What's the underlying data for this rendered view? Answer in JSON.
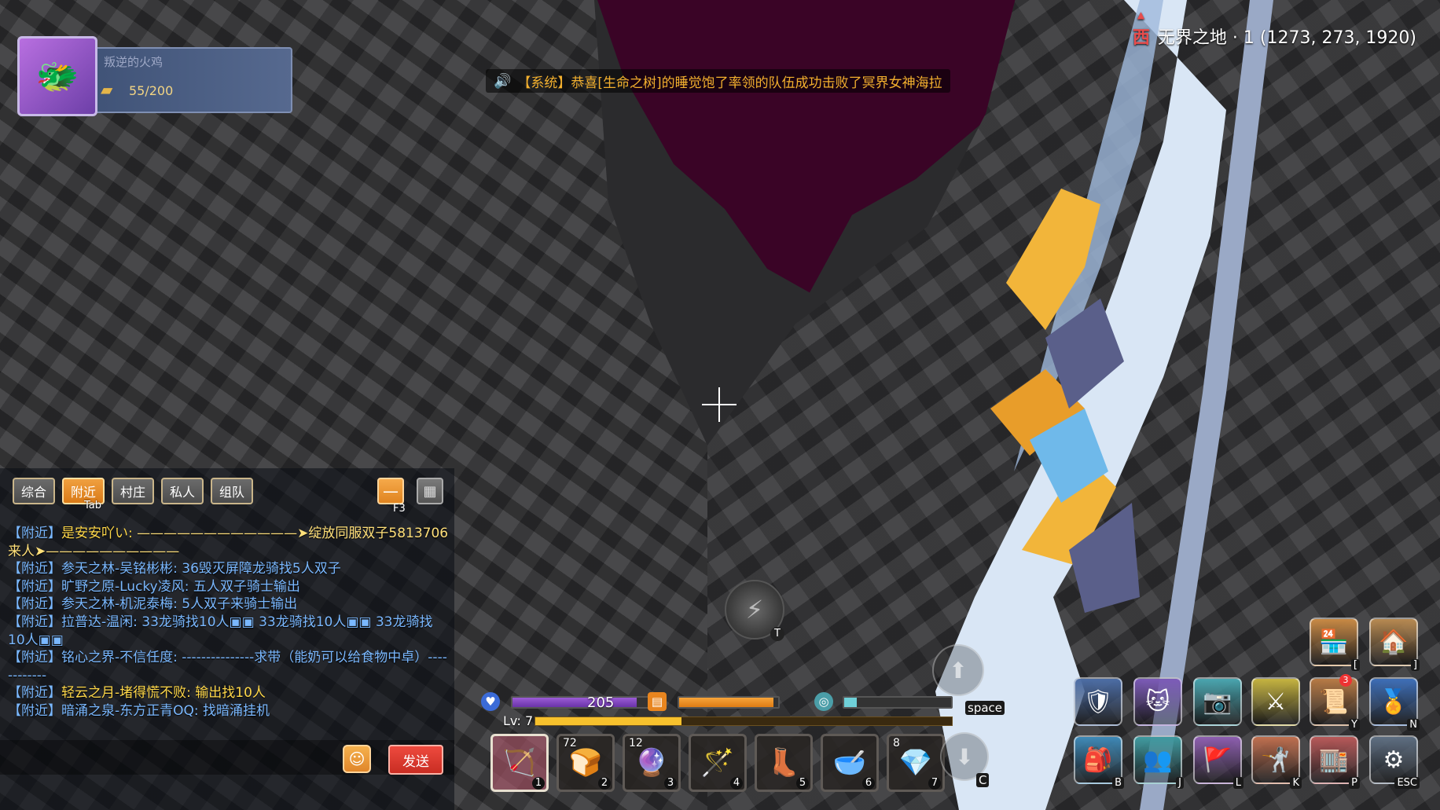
{
  "player": {
    "name": "叛逆的火鸡",
    "capacity": "55/200"
  },
  "location": {
    "direction": "西",
    "text": "无界之地 · 1 (1273, 273, 1920)"
  },
  "notice": {
    "text": "【系统】恭喜[生命之树]的睡觉饱了率领的队伍成功击败了冥界女神海拉"
  },
  "chat": {
    "tabs": [
      "综合",
      "附近",
      "村庄",
      "私人",
      "组队"
    ],
    "active_tab_index": 1,
    "tab_hint": "Tab",
    "collapse_hint": "F3",
    "messages": [
      {
        "channel": "【附近】",
        "sender": "是安安吖い:",
        "text": "————————————➤绽放同服双子5813706来人➤——————————",
        "sender_style": "vip",
        "text_style": "w"
      },
      {
        "channel": "【附近】",
        "sender": "参天之林-吴铭彬彬:",
        "text": "36毁灭屏障龙骑找5人双子",
        "sender_style": "",
        "text_style": ""
      },
      {
        "channel": "【附近】",
        "sender": "旷野之原-Lucky凌风:",
        "text": "五人双子骑士输出",
        "sender_style": "",
        "text_style": ""
      },
      {
        "channel": "【附近】",
        "sender": "参天之林-机泥泰梅:",
        "text": "5人双子来骑士输出",
        "sender_style": "",
        "text_style": ""
      },
      {
        "channel": "【附近】",
        "sender": "拉普达-温闲:",
        "text": "33龙骑找10人▣▣ 33龙骑找10人▣▣ 33龙骑找10人▣▣",
        "sender_style": "",
        "text_style": ""
      },
      {
        "channel": "【附近】",
        "sender": "铭心之界-不信任度:",
        "text": "---------------求带（能奶可以给食物中卓）------------",
        "sender_style": "",
        "text_style": ""
      },
      {
        "channel": "【附近】",
        "sender": "轻云之月-堵得慌不败:",
        "text": "输出找10人",
        "sender_style": "vip",
        "text_style": "y"
      },
      {
        "channel": "【附近】",
        "sender": "暗涌之泉-东方正青OQ:",
        "text": "找暗涌挂机",
        "sender_style": "",
        "text_style": ""
      }
    ],
    "send_label": "发送"
  },
  "status": {
    "hp_value": "205",
    "hp_fraction": 0.9,
    "stamina_fraction": 0.95,
    "mana_fraction": 0.12,
    "level": "Lv: 7",
    "xp_fraction": 0.35
  },
  "hotbar": [
    {
      "key": "1",
      "count": "",
      "icon": "bow-icon",
      "glyph": "🏹",
      "selected": true
    },
    {
      "key": "2",
      "count": "72",
      "icon": "bread-icon",
      "glyph": "🍞",
      "selected": false
    },
    {
      "key": "3",
      "count": "12",
      "icon": "orb-icon",
      "glyph": "🔮",
      "selected": false
    },
    {
      "key": "4",
      "count": "",
      "icon": "staff-icon",
      "glyph": "🪄",
      "selected": false
    },
    {
      "key": "5",
      "count": "",
      "icon": "boots-icon",
      "glyph": "👢",
      "selected": false
    },
    {
      "key": "6",
      "count": "",
      "icon": "bowl-icon",
      "glyph": "🥣",
      "selected": false
    },
    {
      "key": "7",
      "count": "8",
      "icon": "gem-icon",
      "glyph": "💎",
      "selected": false
    }
  ],
  "actions": {
    "jump_key": "space",
    "down_key": "C",
    "totem_key": "T",
    "buttons": [
      {
        "name": "shop-icon",
        "glyph": "🏪",
        "key": "[",
        "color": "#c98a45"
      },
      {
        "name": "home-icon",
        "glyph": "🏠",
        "key": "]",
        "color": "#b88a52"
      },
      {
        "name": "guild-icon",
        "glyph": "🛡",
        "key": "",
        "color": "#4d6ea6"
      },
      {
        "name": "pet-icon",
        "glyph": "🐱",
        "key": "",
        "color": "#7c5bb8"
      },
      {
        "name": "camera-icon",
        "glyph": "📷",
        "key": "",
        "color": "#4aa6b0"
      },
      {
        "name": "battle-icon",
        "glyph": "⚔",
        "key": "",
        "color": "#c6b440"
      },
      {
        "name": "quest-icon",
        "glyph": "📜",
        "key": "Y",
        "color": "#b87b46",
        "badge": "3"
      },
      {
        "name": "achievement-icon",
        "glyph": "🏅",
        "key": "N",
        "color": "#3e6fb8"
      },
      {
        "name": "bag-icon",
        "glyph": "🎒",
        "key": "B",
        "color": "#3f8ab8"
      },
      {
        "name": "friends-icon",
        "glyph": "👥",
        "key": "J",
        "color": "#3f9aa0"
      },
      {
        "name": "flag-icon",
        "glyph": "🚩",
        "key": "L",
        "color": "#8e5fb0"
      },
      {
        "name": "skill-icon",
        "glyph": "🤺",
        "key": "K",
        "color": "#c07050"
      },
      {
        "name": "market-icon",
        "glyph": "🏬",
        "key": "P",
        "color": "#b85a5a"
      },
      {
        "name": "settings-icon",
        "glyph": "⚙",
        "key": "ESC",
        "color": "#5f6f82"
      }
    ]
  }
}
